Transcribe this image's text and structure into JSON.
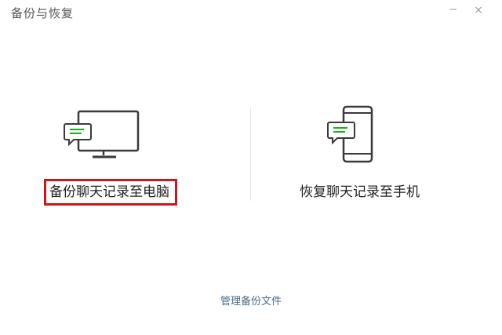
{
  "window": {
    "title": "备份与恢复",
    "minimize_glyph": "−",
    "close_glyph": "×"
  },
  "options": {
    "backup_to_pc": {
      "label": "备份聊天记录至电脑",
      "icon": "monitor-chat-icon",
      "highlighted": true
    },
    "restore_to_phone": {
      "label": "恢复聊天记录至手机",
      "icon": "phone-chat-icon"
    }
  },
  "footer": {
    "manage_link": "管理备份文件"
  },
  "colors": {
    "highlight_border": "#d0141c",
    "chat_bubble_green": "#1aad19",
    "link": "#4a6a8a"
  }
}
